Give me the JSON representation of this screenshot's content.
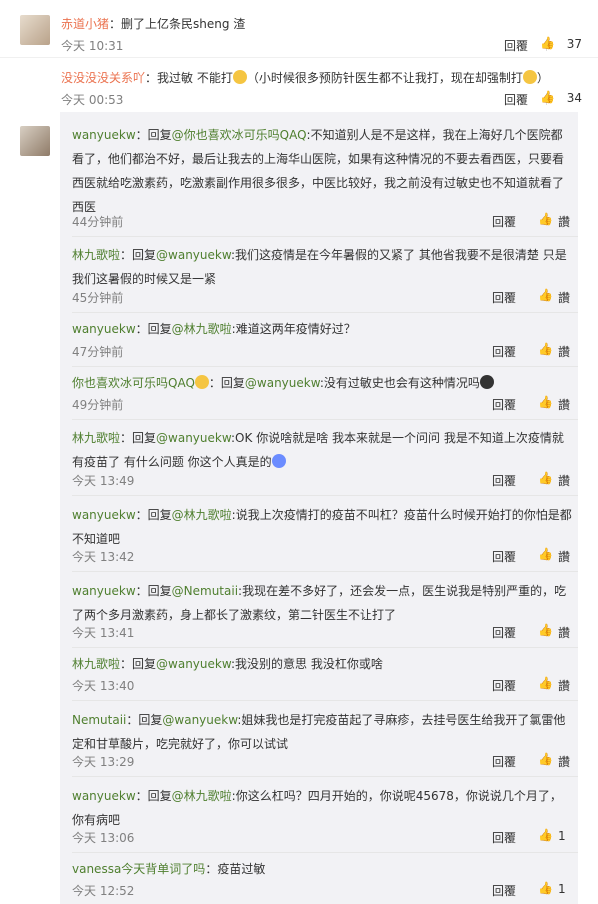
{
  "comments": [
    {
      "user": "赤道小猪",
      "sep": "：",
      "text": "删了上亿条民sheng 渣",
      "time": "今天 10:31",
      "reply": "回覆",
      "likes": "37"
    },
    {
      "user": "没没没没关系吖",
      "sep": "：",
      "text": "我过敏 不能打",
      "text2": "（小时候很多预防针医生都不让我打，现在却强制打",
      "text3": "）",
      "time": "今天 00:53",
      "reply": "回覆",
      "likes": "34"
    }
  ],
  "replies": [
    {
      "user": "wanyuekw",
      "sep": "：回复",
      "mention": "@你也喜欢冰可乐吗QAQ",
      "text": ":不知道别人是不是这样，我在上海好几个医院都看了，他们都治不好，最后让我去的上海华山医院，如果有这种情况的不要去看西医，只要看西医就给吃激素药，吃激素副作用很多很多，中医比较好，我之前没有过敏史也不知道就看了西医",
      "time": "44分钟前",
      "reply": "回覆",
      "likes": "讚"
    },
    {
      "user": "林九歌啦",
      "sep": "：回复",
      "mention": "@wanyuekw",
      "text": ":我们这疫情是在今年暑假的又紧了 其他省我要不是很清楚 只是我们这暑假的时候又是一紧",
      "time": "45分钟前",
      "reply": "回覆",
      "likes": "讚"
    },
    {
      "user": "wanyuekw",
      "sep": "：回复",
      "mention": "@林九歌啦",
      "text": ":难道这两年疫情好过？",
      "time": "47分钟前",
      "reply": "回覆",
      "likes": "讚"
    },
    {
      "user": "你也喜欢冰可乐吗QAQ",
      "sep": "：回复",
      "mention": "@wanyuekw",
      "text": ":没有过敏史也会有这种情况吗",
      "time": "49分钟前",
      "reply": "回覆",
      "likes": "讚"
    },
    {
      "user": "林九歌啦",
      "sep": "：回复",
      "mention": "@wanyuekw",
      "text": ":OK 你说啥就是啥 我本来就是一个问问 我是不知道上次疫情就有疫苗了 有什么问题  你这个人真是的",
      "time": "今天 13:49",
      "reply": "回覆",
      "likes": "讚"
    },
    {
      "user": "wanyuekw",
      "sep": "：回复",
      "mention": "@林九歌啦",
      "text": ":说我上次疫情打的疫苗不叫杠？疫苗什么时候开始打的你怕是都不知道吧",
      "time": "今天 13:42",
      "reply": "回覆",
      "likes": "讚"
    },
    {
      "user": "wanyuekw",
      "sep": "：回复",
      "mention": "@Nemutaii",
      "text": ":我现在差不多好了，还会发一点，医生说我是特别严重的，吃了两个多月激素药，身上都长了激素纹，第二针医生不让打了",
      "time": "今天 13:41",
      "reply": "回覆",
      "likes": "讚"
    },
    {
      "user": "林九歌啦",
      "sep": "：回复",
      "mention": "@wanyuekw",
      "text": ":我没别的意思 我没杠你或啥",
      "time": "今天 13:40",
      "reply": "回覆",
      "likes": "讚"
    },
    {
      "user": "Nemutaii",
      "sep": "：回复",
      "mention": "@wanyuekw",
      "text": ":姐妹我也是打完疫苗起了寻麻疹，去挂号医生给我开了氯雷他定和甘草酸片，吃完就好了，你可以试试",
      "time": "今天 13:29",
      "reply": "回覆",
      "likes": "讚"
    },
    {
      "user": "wanyuekw",
      "sep": "：回复",
      "mention": "@林九歌啦",
      "text": ":你这么杠吗？四月开始的，你说呢45678，你说说几个月了，你有病吧",
      "time": "今天 13:06",
      "reply": "回覆",
      "likes": "1"
    },
    {
      "user": "vanessa今天背单词了吗",
      "sep": "：",
      "mention": "",
      "text": "疫苗过敏",
      "time": "今天 12:52",
      "reply": "回覆",
      "likes": "1"
    }
  ]
}
